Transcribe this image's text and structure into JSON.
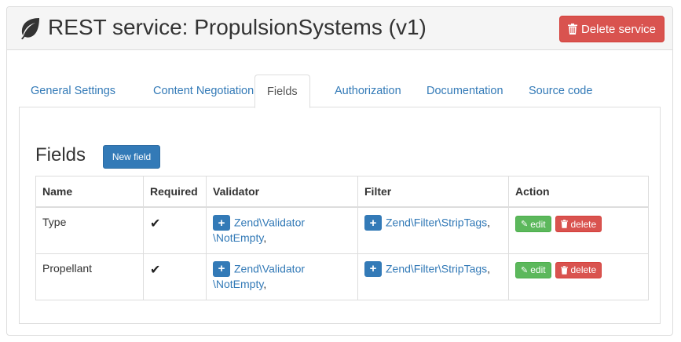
{
  "header": {
    "title": "REST service: PropulsionSystems (v1)",
    "delete_service_label": "Delete service"
  },
  "tabs": [
    {
      "label": "General Settings",
      "active": false
    },
    {
      "label": "Content Negotiation",
      "active": false
    },
    {
      "label": "Fields",
      "active": true
    },
    {
      "label": "Authorization",
      "active": false
    },
    {
      "label": "Documentation",
      "active": false
    },
    {
      "label": "Source code",
      "active": false
    }
  ],
  "fields_section": {
    "title": "Fields",
    "new_field_label": "New field",
    "columns": [
      "Name",
      "Required",
      "Validator",
      "Filter",
      "Action"
    ],
    "rows": [
      {
        "name": "Type",
        "required_mark": "✔",
        "validator_line1": "Zend\\Validator",
        "validator_line2": "\\NotEmpty",
        "filter": "Zend\\Filter\\StripTags",
        "edit_label": "edit",
        "delete_label": "delete"
      },
      {
        "name": "Propellant",
        "required_mark": "✔",
        "validator_line1": "Zend\\Validator",
        "validator_line2": "\\NotEmpty",
        "filter": "Zend\\Filter\\StripTags",
        "edit_label": "edit",
        "delete_label": "delete"
      }
    ]
  },
  "icons": {
    "brand": "leaf-icon",
    "delete": "trash-icon",
    "add": "plus-icon",
    "edit": "pencil-icon",
    "required": "check-icon"
  },
  "colors": {
    "primary": "#337ab7",
    "danger": "#d9534f",
    "success": "#5cb85c",
    "heading_bg": "#f5f5f5",
    "border": "#dddddd"
  }
}
